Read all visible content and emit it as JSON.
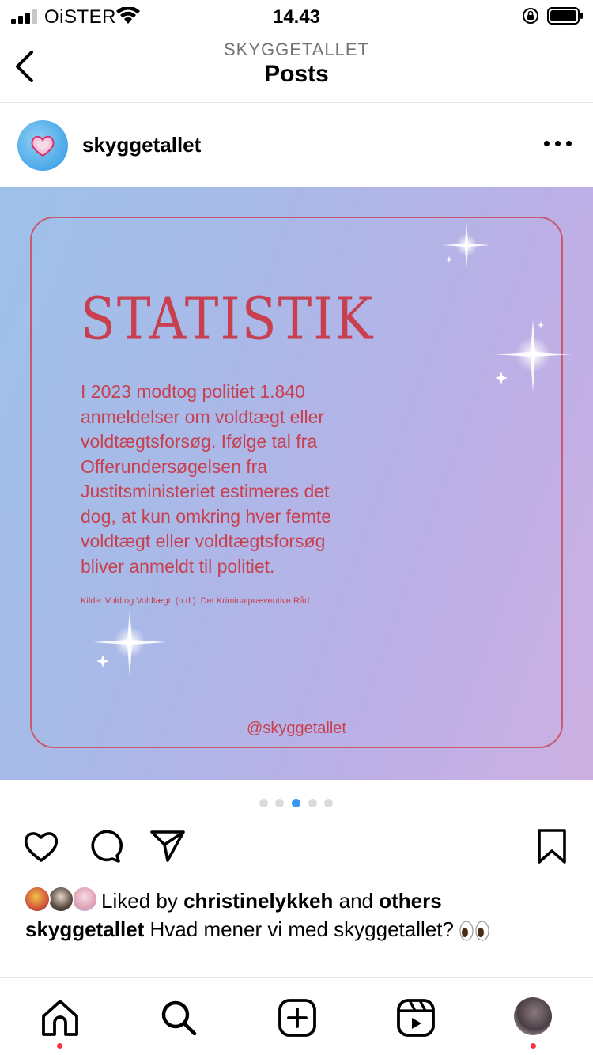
{
  "status_bar": {
    "carrier": "OiSTER",
    "time": "14.43"
  },
  "header": {
    "subtitle": "SKYGGETALLET",
    "title": "Posts"
  },
  "post": {
    "username": "skyggetallet",
    "carousel": {
      "count": 5,
      "active_index": 2
    },
    "image": {
      "heading": "STATISTIK",
      "body_lines": [
        "I 2023 modtog politiet 1.840",
        "anmeldelser om voldtægt eller",
        "voldtægtsforsøg. Ifølge tal fra",
        "Offerundersøgelsen fra",
        "Justitsministeriet estimeres det",
        "dog, at kun omkring hver femte",
        "voldtægt eller voldtægtsforsøg",
        "bliver anmeldt til politiet."
      ],
      "source": "Kilde: Vold og Voldtægt. (n.d.). Det Kriminalpræventive Råd",
      "handle": "@skyggetallet",
      "accent_color": "#c8404f"
    },
    "likes": {
      "prefix": "Liked by ",
      "user": "christinelykkeh",
      "middle": " and ",
      "others": "others"
    },
    "caption": {
      "username": "skyggetallet",
      "text": " Hvad mener vi med skyggetallet?"
    }
  },
  "icons": {
    "back": "chevron-left-icon",
    "more": "more-horizontal-icon",
    "like": "heart-icon",
    "comment": "comment-icon",
    "share": "paper-plane-icon",
    "save": "bookmark-icon",
    "nav": [
      "home-icon",
      "search-icon",
      "create-icon",
      "reels-icon",
      "profile-avatar"
    ]
  },
  "colors": {
    "active_dot": "#3897f0",
    "notification_dot": "#ff3040"
  }
}
